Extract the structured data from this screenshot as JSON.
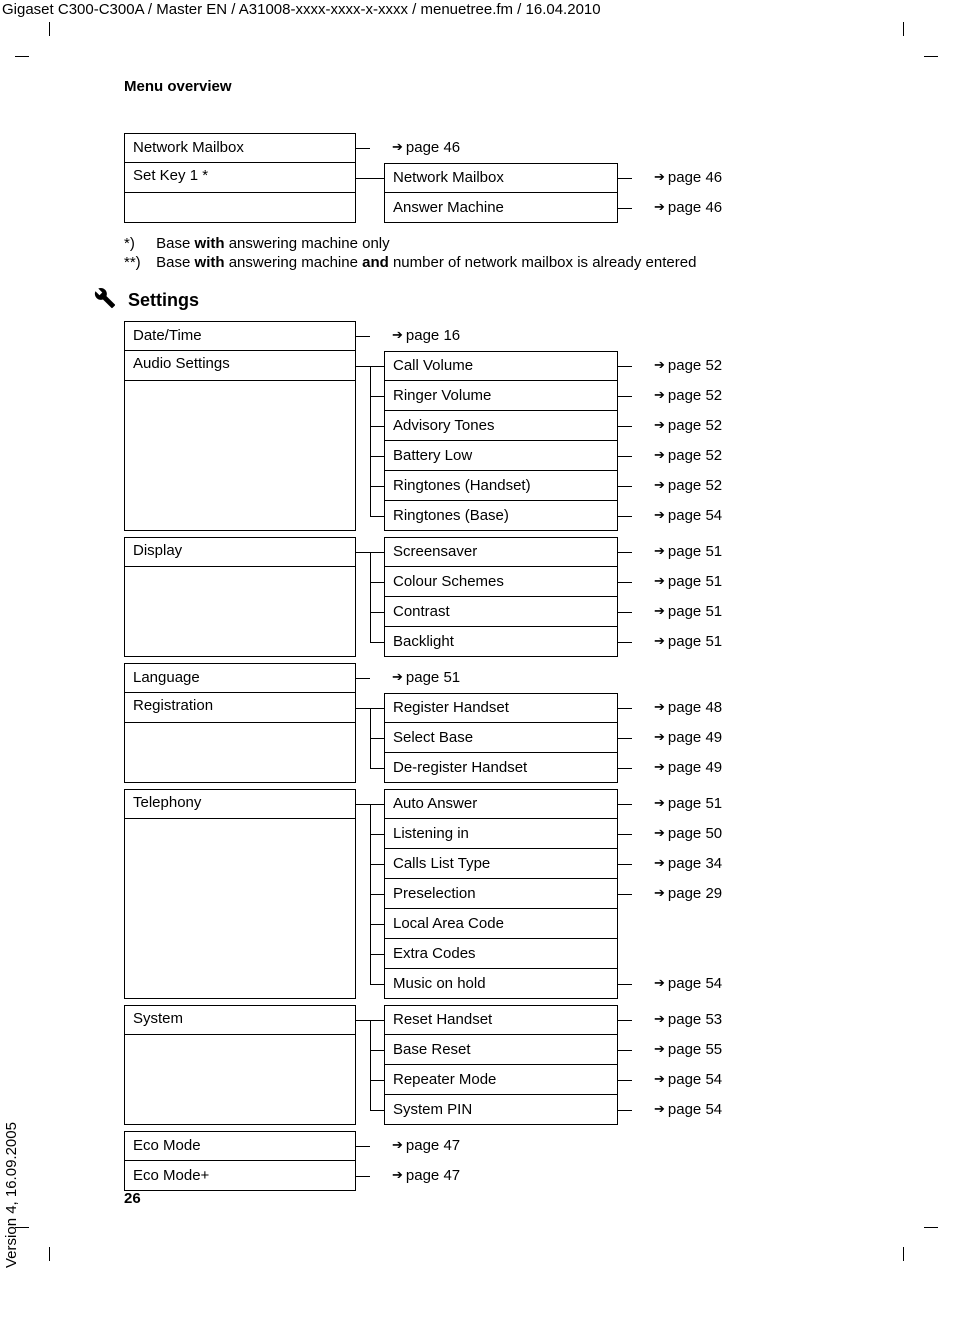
{
  "header_path": "Gigaset C300-C300A / Master EN / A31008-xxxx-xxxx-x-xxxx / menuetree.fm / 16.04.2010",
  "version_side": "Version 4, 16.09.2005",
  "running_head": "Menu overview",
  "page_number": "26",
  "top_tree": {
    "rows": [
      {
        "label": "Network Mailbox",
        "ref": "page 46"
      },
      {
        "label": "Set Key 1 *",
        "children": [
          {
            "label": "Network Mailbox",
            "ref": "page 46"
          },
          {
            "label": "Answer Machine",
            "ref": "page 46"
          }
        ]
      }
    ]
  },
  "footnotes": {
    "f1_mark": "*)",
    "f1_pre": "Base ",
    "f1_bold": "with",
    "f1_post": " answering machine only",
    "f2_mark": "**)",
    "f2_pre": "Base ",
    "f2_b1": "with",
    "f2_mid": " answering machine ",
    "f2_b2": "and",
    "f2_post": " number of network mailbox is already entered"
  },
  "settings_title": "Settings",
  "settings": [
    {
      "label": "Date/Time",
      "ref": "page 16"
    },
    {
      "label": "Audio Settings",
      "children": [
        {
          "label": "Call Volume",
          "ref": "page 52"
        },
        {
          "label": "Ringer Volume",
          "ref": "page 52"
        },
        {
          "label": "Advisory Tones",
          "ref": "page 52"
        },
        {
          "label": "Battery Low",
          "ref": "page 52"
        },
        {
          "label": "Ringtones (Handset)",
          "ref": "page 52"
        },
        {
          "label": "Ringtones (Base)",
          "ref": "page 54"
        }
      ]
    },
    {
      "label": "Display",
      "children": [
        {
          "label": "Screensaver",
          "ref": "page 51"
        },
        {
          "label": "Colour Schemes",
          "ref": "page 51"
        },
        {
          "label": "Contrast",
          "ref": "page 51"
        },
        {
          "label": "Backlight",
          "ref": "page 51"
        }
      ]
    },
    {
      "label": "Language",
      "ref": "page 51"
    },
    {
      "label": "Registration",
      "children": [
        {
          "label": "Register Handset",
          "ref": "page 48"
        },
        {
          "label": "Select Base",
          "ref": "page 49"
        },
        {
          "label": "De-register Handset",
          "ref": "page 49"
        }
      ]
    },
    {
      "label": "Telephony",
      "children": [
        {
          "label": "Auto Answer",
          "ref": "page 51"
        },
        {
          "label": "Listening in",
          "ref": "page 50"
        },
        {
          "label": "Calls List Type",
          "ref": "page 34"
        },
        {
          "label": "Preselection",
          "ref": "page 29"
        },
        {
          "label": "Local Area Code",
          "ref": ""
        },
        {
          "label": "Extra Codes",
          "ref": ""
        },
        {
          "label": "Music on hold",
          "ref": "page 54"
        }
      ]
    },
    {
      "label": "System",
      "children": [
        {
          "label": "Reset Handset",
          "ref": "page 53"
        },
        {
          "label": "Base Reset",
          "ref": "page 55"
        },
        {
          "label": "Repeater Mode",
          "ref": "page 54"
        },
        {
          "label": "System PIN",
          "ref": "page 54"
        }
      ]
    },
    {
      "label": "Eco Mode",
      "ref": "page 47"
    },
    {
      "label": "Eco Mode+",
      "ref": "page 47"
    }
  ]
}
